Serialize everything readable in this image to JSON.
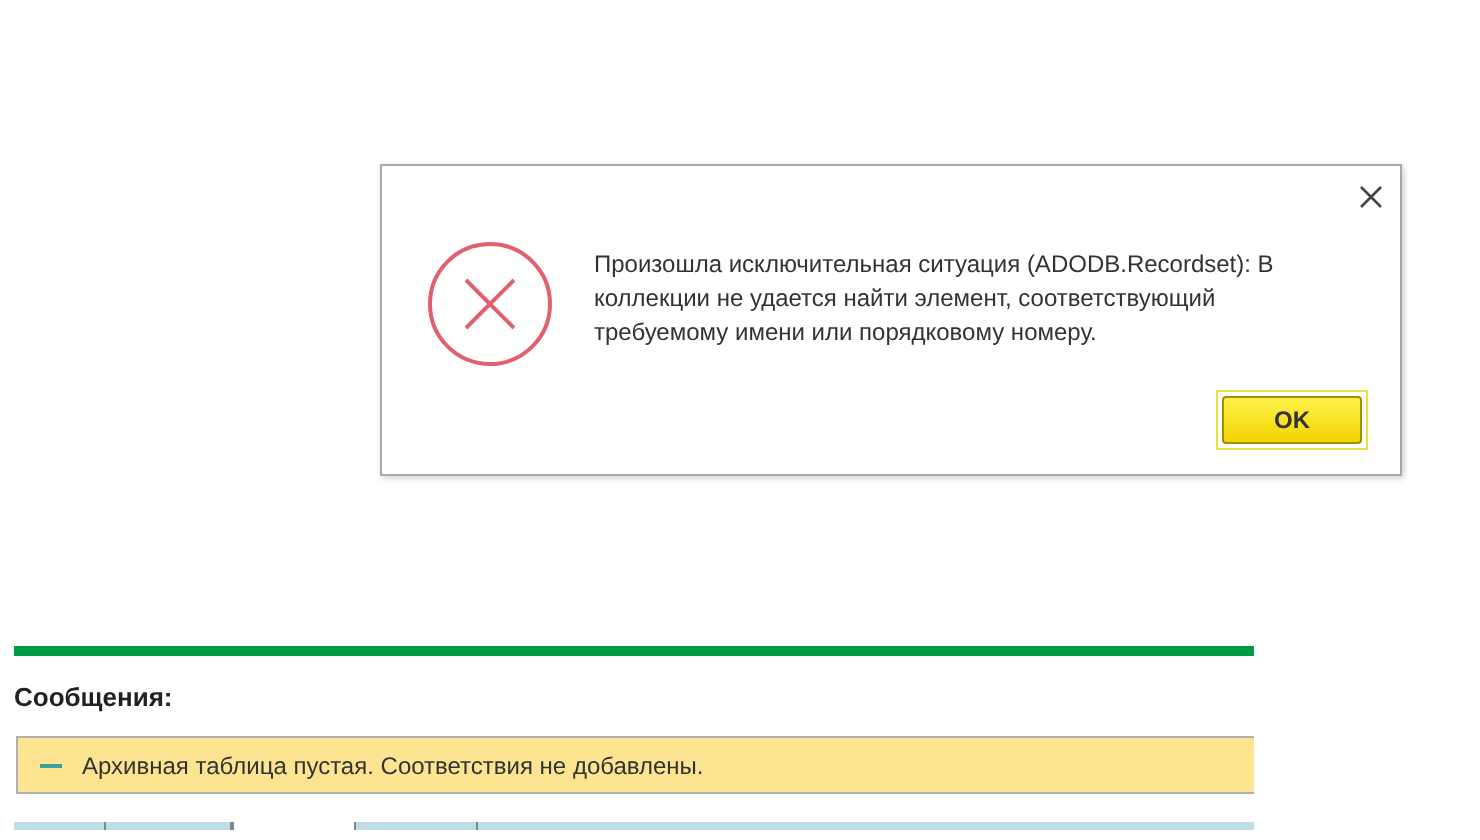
{
  "dialog": {
    "message": "Произошла исключительная ситуация (ADODB.Recordset): В коллекции не удается найти элемент, соответствующий требуемому имени или порядковому номеру.",
    "buttons": [
      {
        "label": "OK",
        "selected": true
      }
    ]
  },
  "messages_panel": {
    "title": "Сообщения:",
    "items": [
      {
        "text": "Архивная таблица пустая. Соответствия не добавлены."
      }
    ]
  }
}
